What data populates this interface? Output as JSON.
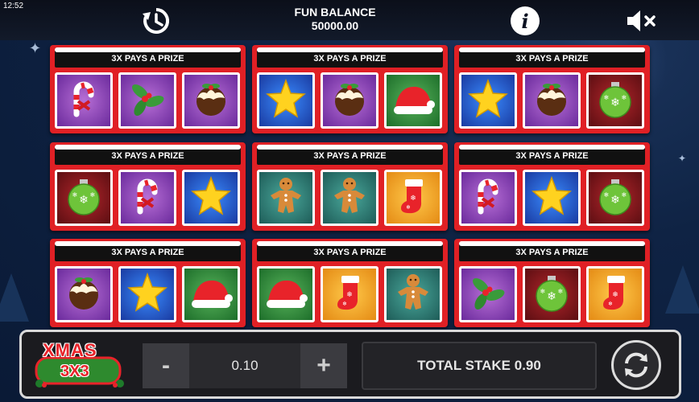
{
  "status_bar": {
    "time": "12:52"
  },
  "header": {
    "balance_label": "FUN BALANCE",
    "balance_value": "50000.00",
    "history_icon": "history-icon",
    "info_icon": "info-icon",
    "info_glyph": "i",
    "mute_icon": "mute-icon"
  },
  "cards": [
    {
      "banner": "3X PAYS A PRIZE",
      "tiles": [
        {
          "symbol": "candy-cane",
          "bg": "purple"
        },
        {
          "symbol": "holly",
          "bg": "purple"
        },
        {
          "symbol": "christmas-pudding",
          "bg": "purple"
        }
      ]
    },
    {
      "banner": "3X PAYS A PRIZE",
      "tiles": [
        {
          "symbol": "star",
          "bg": "blue"
        },
        {
          "symbol": "christmas-pudding",
          "bg": "purple"
        },
        {
          "symbol": "santa-hat",
          "bg": "green"
        }
      ]
    },
    {
      "banner": "3X PAYS A PRIZE",
      "tiles": [
        {
          "symbol": "star",
          "bg": "blue"
        },
        {
          "symbol": "christmas-pudding",
          "bg": "purple"
        },
        {
          "symbol": "bauble",
          "bg": "red"
        }
      ]
    },
    {
      "banner": "3X PAYS A PRIZE",
      "tiles": [
        {
          "symbol": "bauble",
          "bg": "red"
        },
        {
          "symbol": "candy-cane",
          "bg": "purple"
        },
        {
          "symbol": "star",
          "bg": "blue"
        }
      ]
    },
    {
      "banner": "3X PAYS A PRIZE",
      "tiles": [
        {
          "symbol": "gingerbread-man",
          "bg": "teal"
        },
        {
          "symbol": "gingerbread-man",
          "bg": "teal"
        },
        {
          "symbol": "stocking",
          "bg": "orange"
        }
      ]
    },
    {
      "banner": "3X PAYS A PRIZE",
      "tiles": [
        {
          "symbol": "candy-cane",
          "bg": "purple"
        },
        {
          "symbol": "star",
          "bg": "blue"
        },
        {
          "symbol": "bauble",
          "bg": "red"
        }
      ]
    },
    {
      "banner": "3X PAYS A PRIZE",
      "tiles": [
        {
          "symbol": "christmas-pudding",
          "bg": "purple"
        },
        {
          "symbol": "star",
          "bg": "blue"
        },
        {
          "symbol": "santa-hat",
          "bg": "green"
        }
      ]
    },
    {
      "banner": "3X PAYS A PRIZE",
      "tiles": [
        {
          "symbol": "santa-hat",
          "bg": "green"
        },
        {
          "symbol": "stocking",
          "bg": "orange"
        },
        {
          "symbol": "gingerbread-man",
          "bg": "teal"
        }
      ]
    },
    {
      "banner": "3X PAYS A PRIZE",
      "tiles": [
        {
          "symbol": "holly",
          "bg": "purple"
        },
        {
          "symbol": "bauble",
          "bg": "red"
        },
        {
          "symbol": "stocking",
          "bg": "orange"
        }
      ]
    }
  ],
  "footer": {
    "logo_line1": "XMAS",
    "logo_line2": "3X3",
    "minus_label": "-",
    "plus_label": "+",
    "stake_value": "0.10",
    "total_stake_label": "TOTAL STAKE 0.90",
    "spin_icon": "spin-icon"
  },
  "colors": {
    "card_red": "#e02025",
    "bar_dark": "#1b1b1f",
    "sky": "#0f2344"
  }
}
